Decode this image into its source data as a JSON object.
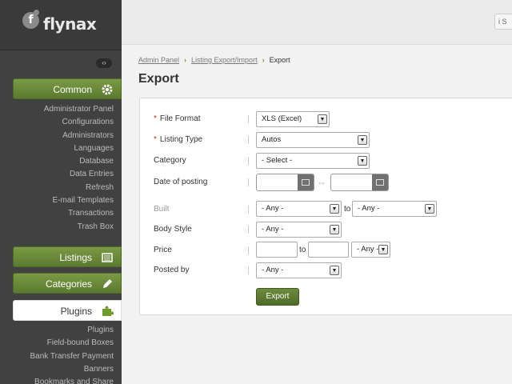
{
  "brand": {
    "name": "flynax",
    "mark": "f"
  },
  "header": {
    "button_label": "i S"
  },
  "sidebar": {
    "collapse_label": "‹›",
    "common": {
      "label": "Common",
      "icon": "gear-icon",
      "items": [
        "Administrator Panel",
        "Configurations",
        "Administrators",
        "Languages",
        "Database",
        "Data Entries",
        "Refresh",
        "E-mail Templates",
        "Transactions",
        "Trash Box"
      ]
    },
    "listings": {
      "label": "Listings",
      "icon": "listing-icon"
    },
    "categories": {
      "label": "Categories",
      "icon": "pencil-icon"
    },
    "plugins": {
      "label": "Plugins",
      "icon": "puzzle-icon",
      "items": [
        "Plugins",
        "Field-bound Boxes",
        "Bank Transfer Payment",
        "Banners",
        "Bookmarks and Share"
      ]
    }
  },
  "breadcrumb": [
    "Admin Panel",
    "Listing Export/Import",
    "Export"
  ],
  "page_title": "Export",
  "form": {
    "file_format": {
      "label": "File Format",
      "value": "XLS (Excel)"
    },
    "listing_type": {
      "label": "Listing Type",
      "value": "Autos"
    },
    "category": {
      "label": "Category",
      "value": "- Select -"
    },
    "date_of_posting": {
      "label": "Date of posting",
      "swap": "↔"
    },
    "built": {
      "label": "Built",
      "from": "- Any -",
      "to_label": "to",
      "to": "- Any -"
    },
    "body_style": {
      "label": "Body Style",
      "value": "- Any -"
    },
    "price": {
      "label": "Price",
      "to_label": "to",
      "currency": "- Any -"
    },
    "posted_by": {
      "label": "Posted by",
      "value": "- Any -"
    },
    "required_mark": "*",
    "submit": "Export"
  },
  "colors": {
    "accent": "#5b7a2f",
    "sidebar": "#414141",
    "required": "#c03030"
  }
}
